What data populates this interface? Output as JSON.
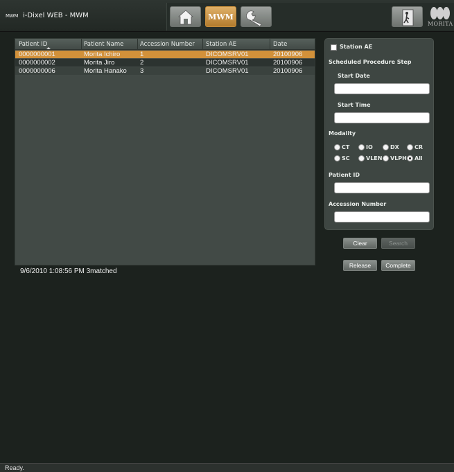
{
  "app": {
    "logo_text": "MWM",
    "title": "i-Dixel WEB - MWM",
    "nav_mwm_label": "MWM",
    "brand": "MORITA"
  },
  "grid": {
    "columns": [
      "Patient ID",
      "Patient Name",
      "Accession Number",
      "Station AE",
      "Date"
    ],
    "rows": [
      {
        "patient_id": "0000000001",
        "patient_name": "Morita Ichiro",
        "accession": "1",
        "station_ae": "DICOMSRV01",
        "date": "20100906"
      },
      {
        "patient_id": "0000000002",
        "patient_name": "Morita Jiro",
        "accession": "2",
        "station_ae": "DICOMSRV01",
        "date": "20100906"
      },
      {
        "patient_id": "0000000006",
        "patient_name": "Morita Hanako",
        "accession": "3",
        "station_ae": "DICOMSRV01",
        "date": "20100906"
      }
    ],
    "status": "9/6/2010 1:08:56 PM 3matched"
  },
  "search": {
    "station_ae_label": "Station AE",
    "sps_label": "Scheduled Procedure Step",
    "start_date_label": "Start Date",
    "start_date_value": "",
    "start_time_label": "Start Time",
    "start_time_value": "",
    "modality_label": "Modality",
    "modalities": [
      "CT",
      "IO",
      "DX",
      "CR",
      "SC",
      "VLEN",
      "VLPH",
      "All"
    ],
    "selected_modality": "All",
    "patient_id_label": "Patient ID",
    "patient_id_value": "",
    "accession_label": "Accession Number",
    "accession_value": ""
  },
  "buttons": {
    "clear": "Clear",
    "search": "Search",
    "release": "Release",
    "complete": "Complete"
  },
  "statusbar": {
    "text": "Ready."
  }
}
